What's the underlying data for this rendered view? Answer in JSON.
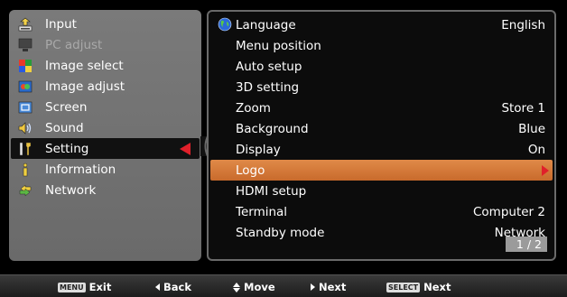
{
  "left_menu": {
    "items": [
      {
        "label": "Input",
        "icon": "input-icon",
        "state": "normal"
      },
      {
        "label": "PC adjust",
        "icon": "pc-adjust-icon",
        "state": "disabled"
      },
      {
        "label": "Image select",
        "icon": "image-select-icon",
        "state": "normal"
      },
      {
        "label": "Image adjust",
        "icon": "image-adjust-icon",
        "state": "normal"
      },
      {
        "label": "Screen",
        "icon": "screen-icon",
        "state": "normal"
      },
      {
        "label": "Sound",
        "icon": "sound-icon",
        "state": "normal"
      },
      {
        "label": "Setting",
        "icon": "setting-icon",
        "state": "selected"
      },
      {
        "label": "Information",
        "icon": "information-icon",
        "state": "normal"
      },
      {
        "label": "Network",
        "icon": "network-icon",
        "state": "normal"
      }
    ]
  },
  "settings_menu": {
    "items": [
      {
        "label": "Language",
        "value": "English"
      },
      {
        "label": "Menu position",
        "value": ""
      },
      {
        "label": "Auto setup",
        "value": ""
      },
      {
        "label": "3D setting",
        "value": ""
      },
      {
        "label": "Zoom",
        "value": "Store 1"
      },
      {
        "label": "Background",
        "value": "Blue"
      },
      {
        "label": "Display",
        "value": "On"
      },
      {
        "label": "Logo",
        "value": ""
      },
      {
        "label": "HDMI setup",
        "value": ""
      },
      {
        "label": "Terminal",
        "value": "Computer 2"
      },
      {
        "label": "Standby mode",
        "value": "Network"
      }
    ],
    "page": "1 / 2"
  },
  "bottom_bar": {
    "exit_key": "MENU",
    "exit_label": "Exit",
    "back_label": "Back",
    "move_label": "Move",
    "next_label": "Next",
    "select_key": "SELECT",
    "select_label": "Next"
  },
  "colors": {
    "highlight": "#d87a38",
    "selection_arrow": "#e0202a",
    "panel_gray": "#707070"
  }
}
